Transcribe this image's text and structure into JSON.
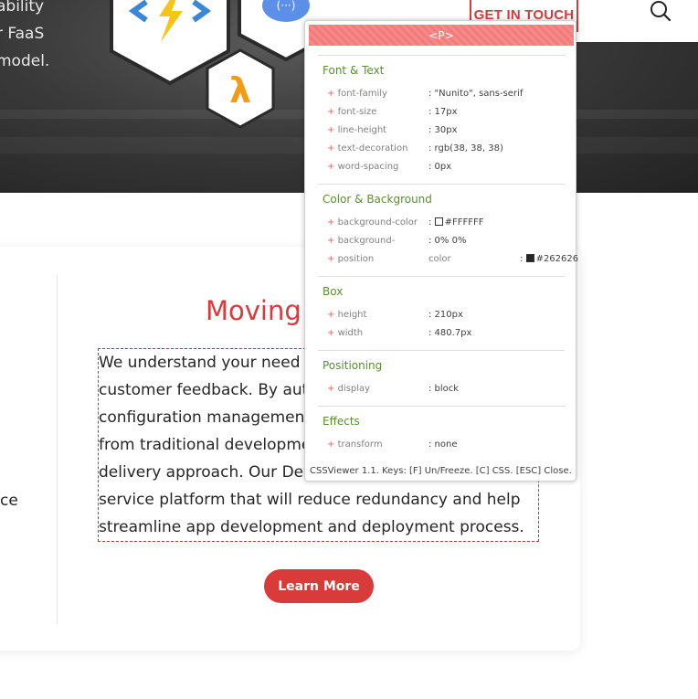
{
  "hero": {
    "lines": [
      "ability",
      "r FaaS",
      "model."
    ],
    "lambda_symbol": "λ"
  },
  "nav": {
    "cta_label": "GET IN TOUCH"
  },
  "card": {
    "left_fragment": "ce",
    "title": "Moving t",
    "paragraph_lines": [
      "We understand your need to l",
      "customer feedback. By autom",
      "configuration management to",
      "from traditional development",
      "delivery approach. Our DevOp",
      "service platform that will reduce redundancy and help",
      "streamline app development and deployment process."
    ],
    "button_label": "Learn More"
  },
  "cssviewer": {
    "header": "<P>",
    "sections": {
      "font_text": {
        "title": "Font & Text",
        "rows": [
          {
            "prop": "font-family",
            "value": ": \"Nunito\", sans-serif"
          },
          {
            "prop": "font-size",
            "value": ": 17px"
          },
          {
            "prop": "line-height",
            "value": ": 30px"
          },
          {
            "prop": "text-decoration",
            "value": ": rgb(38, 38, 38)"
          },
          {
            "prop": "word-spacing",
            "value": ": 0px"
          }
        ]
      },
      "color_bg": {
        "title": "Color & Background",
        "bg_color_prop": "background-color",
        "bg_color_value": "#FFFFFF",
        "bg_color_swatch": "#ffffff",
        "bg_pos_prop1": "background-",
        "bg_pos_prop2": "position",
        "bg_pos_value": ": 0% 0%",
        "color_prop": "color",
        "color_value": "#262626",
        "color_swatch": "#262626"
      },
      "box": {
        "title": "Box",
        "rows": [
          {
            "prop": "height",
            "value": ": 210px"
          },
          {
            "prop": "width",
            "value": ": 480.7px"
          }
        ]
      },
      "positioning": {
        "title": "Positioning",
        "rows": [
          {
            "prop": "display",
            "value": ": block"
          }
        ]
      },
      "effects": {
        "title": "Effects",
        "rows": [
          {
            "prop": "transform",
            "value": ": none"
          }
        ]
      }
    },
    "footer": "CSSViewer 1.1. Keys: [F] Un/Freeze. [C] CSS. [ESC] Close."
  },
  "colors": {
    "accent": "#d93a3a",
    "text": "#262626",
    "section_green": "#5a8f2f"
  }
}
